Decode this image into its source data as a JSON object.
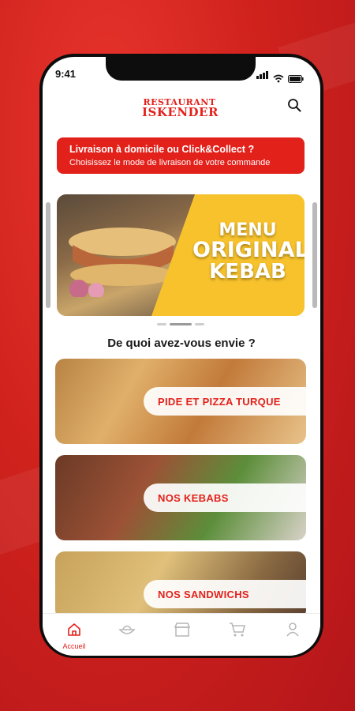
{
  "status": {
    "time": "9:41"
  },
  "header": {
    "logo_line1": "RESTAURANT",
    "logo_line2": "ISKENDER"
  },
  "banner": {
    "title": "Livraison à domicile ou Click&Collect ?",
    "subtitle": "Choisissez le mode de livraison de votre commande"
  },
  "hero": {
    "line1": "MENU",
    "line2": "ORIGINAL",
    "line3": "KEBAB"
  },
  "section_title": "De quoi avez-vous envie ?",
  "categories": [
    {
      "label": "PIDE ET PIZZA TURQUE"
    },
    {
      "label": "NOS KEBABS"
    },
    {
      "label": "NOS SANDWICHS"
    }
  ],
  "tabbar": {
    "home_label": "Accueil"
  },
  "colors": {
    "brand": "#e3211b",
    "accent_yellow": "#f7c22c"
  }
}
